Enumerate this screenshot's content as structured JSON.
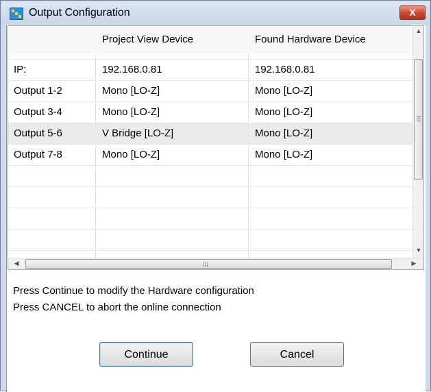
{
  "window": {
    "title": "Output Configuration",
    "close_label": "X"
  },
  "grid": {
    "columns": [
      "",
      "Project View Device",
      "Found Hardware Device"
    ],
    "rows": [
      [
        "IP:",
        "192.168.0.81",
        "192.168.0.81"
      ],
      [
        "Output 1-2",
        "Mono [LO-Z]",
        "Mono [LO-Z]"
      ],
      [
        "Output 3-4",
        "Mono [LO-Z]",
        "Mono [LO-Z]"
      ],
      [
        "Output 5-6",
        "V Bridge [LO-Z]",
        "Mono [LO-Z]"
      ],
      [
        "Output 7-8",
        "Mono [LO-Z]",
        "Mono [LO-Z]"
      ]
    ],
    "selected_row_label": "Output 5-6"
  },
  "message": {
    "line1": "Press Continue to modify the Hardware configuration",
    "line2": "Press CANCEL to abort the online connection"
  },
  "buttons": {
    "continue_label": "Continue",
    "cancel_label": "Cancel"
  },
  "icons": {
    "app": "app-icon",
    "close": "close-icon",
    "scroll_up": "chevron-up-icon",
    "scroll_down": "chevron-down-icon",
    "scroll_left": "chevron-left-icon",
    "scroll_right": "chevron-right-icon"
  },
  "colors": {
    "title_bar": "#c7d6e9",
    "close_button": "#c8442c",
    "selected_row": "#ebebeb"
  }
}
